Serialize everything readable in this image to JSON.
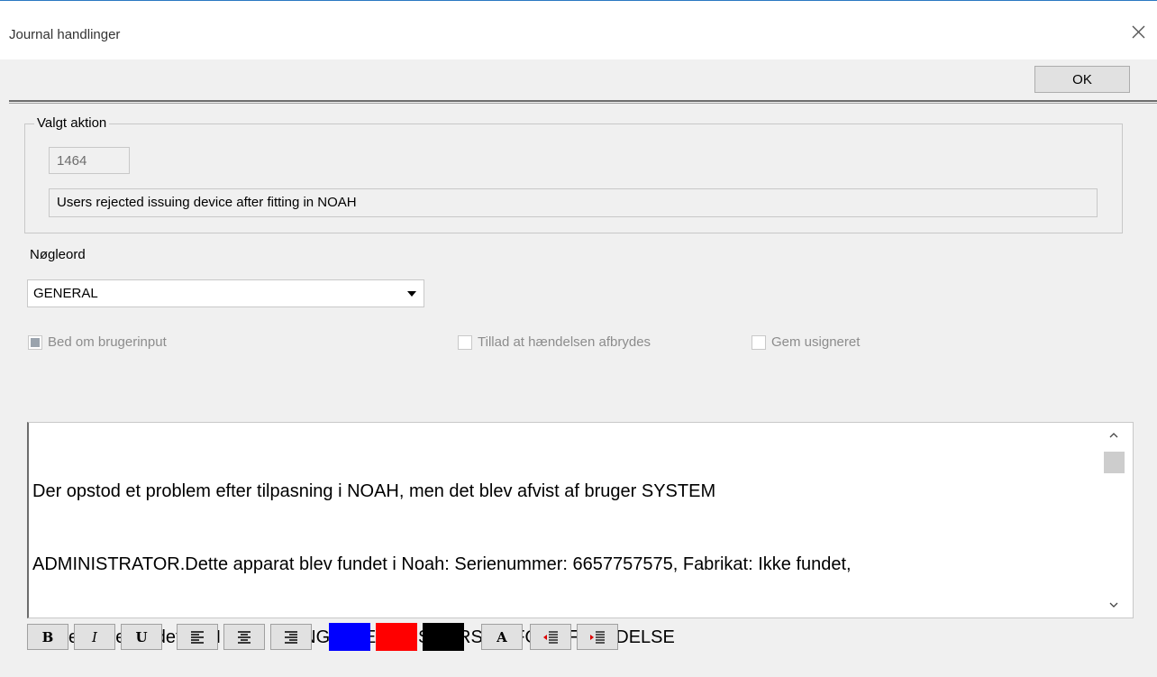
{
  "window": {
    "title": "Journal handlinger"
  },
  "toolbar": {
    "ok_label": "OK"
  },
  "selected_action": {
    "group_label": "Valgt aktion",
    "id": "1464",
    "description": "Users rejected issuing device after fitting in NOAH"
  },
  "keyword": {
    "label": "Nøgleord",
    "value": "GENERAL"
  },
  "options": {
    "request_input": {
      "label": "Bed om brugerinput",
      "checked": true
    },
    "allow_interrupt": {
      "label": "Tillad at hændelsen afbrydes",
      "checked": false
    },
    "save_unsigned": {
      "label": "Gem usigneret",
      "checked": false
    }
  },
  "editor": {
    "line1": "Der opstod et problem efter tilpasning i NOAH, men det blev afvist af bruger SYSTEM",
    "line2": "ADMINISTRATOR.Dette apparat blev fundet i Noah: Serienummer: 6657757575, Fabrikat: Ikke fundet,",
    "line3": "Artikel: Ikke fundet, V/H side: H; ANGIV VENLIGST ÅRSAG FOR AFBRYDELSE"
  },
  "format_bar": {
    "bold": "B",
    "italic": "I",
    "underline": "U",
    "font": "A",
    "colors": {
      "blue": "#0000ff",
      "red": "#ff0000",
      "black": "#000000"
    }
  }
}
